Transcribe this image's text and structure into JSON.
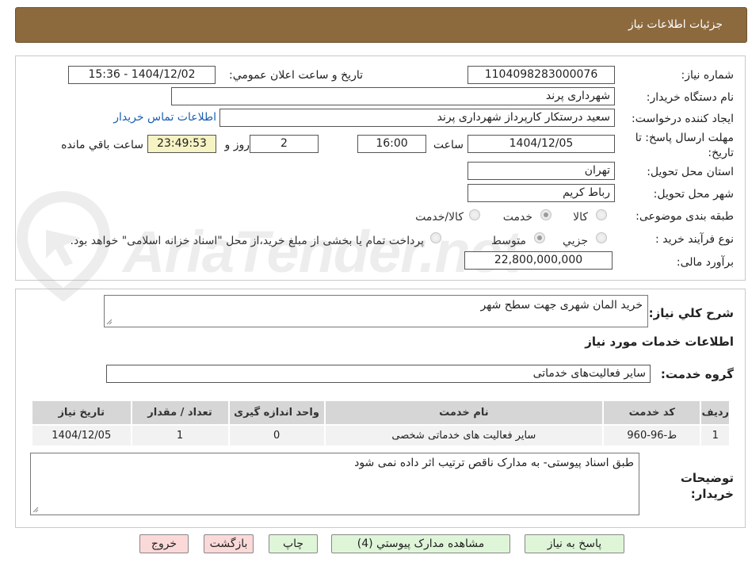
{
  "header": {
    "title": "جزئیات اطلاعات نیاز"
  },
  "fields": {
    "need_number_label": "شماره نیاز:",
    "need_number": "1104098283000076",
    "announce_label": "تاریخ و ساعت اعلان عمومي:",
    "announce_value": "1404/12/02 - 15:36",
    "buyer_org_label": "نام دستگاه خريدار:",
    "buyer_org": "شهرداری پرند",
    "creator_label": "ايجاد کننده درخواست:",
    "creator": "سعید درستکار کارپرداز شهرداری پرند",
    "contact_link": "اطلاعات تماس خريدار",
    "deadline_label": "مهلت ارسال پاسخ: تا تاريخ:",
    "deadline_date": "1404/12/05",
    "time_label": "ساعت",
    "deadline_time": "16:00",
    "days_value": "2",
    "days_label": "روز و",
    "remaining_time": "23:49:53",
    "remaining_label": "ساعت باقي مانده",
    "province_label": "استان محل تحویل:",
    "province": "تهران",
    "city_label": "شهر محل تحویل:",
    "city": "رباط کریم",
    "category_label": "طبقه بندی موضوعی:",
    "category_options": [
      "کالا",
      "خدمت",
      "کالا/خدمت"
    ],
    "category_selected": "خدمت",
    "process_label": "نوع فرآیند خرید :",
    "process_options": [
      "جزيي",
      "متوسط"
    ],
    "process_selected": "متوسط",
    "process_note": "پرداخت تمام یا بخشی از مبلغ خرید،از محل \"اسناد خزانه اسلامی\" خواهد بود.",
    "budget_label": "برآورد مالی:",
    "budget": "22,800,000,000"
  },
  "watermark": {
    "text": "AriaTender.net"
  },
  "summary": {
    "label": "شرح کلي نياز:",
    "value": "خرید المان شهری جهت سطح شهر"
  },
  "services": {
    "section_title": "اطلاعات خدمات مورد نياز",
    "group_label": "گروه خدمت:",
    "group_value": "سایر فعالیت‌های خدماتی"
  },
  "table": {
    "headers": [
      "رديف",
      "کد خدمت",
      "نام خدمت",
      "واحد اندازه گيری",
      "تعداد / مقدار",
      "تاريخ نياز"
    ],
    "rows": [
      [
        "1",
        "ط-96-960",
        "سایر فعالیت های خدماتی شخصی",
        "0",
        "1",
        "1404/12/05"
      ]
    ]
  },
  "notes": {
    "label": "توضيحات خريدار:",
    "value": "طبق اسناد پیوستی- به مدارک ناقص ترتیب اثر داده نمی شود"
  },
  "buttons": {
    "reply": "پاسخ به نياز",
    "attachments": "مشاهده مدارک پيوستي (4)",
    "print": "چاپ",
    "back": "بازگشت",
    "exit": "خروج"
  },
  "colors": {
    "header_bg": "#8c6a3e",
    "button_green": "#dff5d8",
    "button_red": "#fcd9d9",
    "timer_bg": "#f6f3c4",
    "link": "#1a5fb4"
  }
}
